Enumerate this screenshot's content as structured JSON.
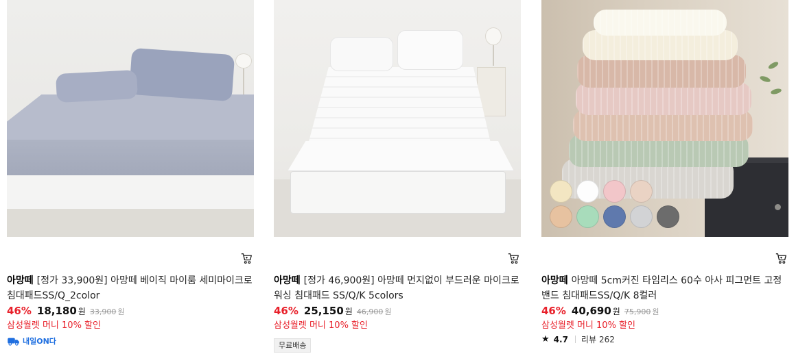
{
  "products": [
    {
      "brand": "아망떼",
      "title": "[정가 33,900원] 아망떼 베이직 마이룸 세미마이크로 침대패드SS/Q_2color",
      "discount": "46%",
      "price": "18,180",
      "currency": "원",
      "original_price": "33,900",
      "promo": "삼성월렛 머니 10% 할인",
      "delivery_badge": "내일ON다",
      "image": "grey-bed-pad-photo"
    },
    {
      "brand": "아망떼",
      "title": "[정가 46,900원] 아망떼 먼지없이 부드러운 마이크로 워싱 침대패드 SS/Q/K 5colors",
      "discount": "46%",
      "price": "25,150",
      "currency": "원",
      "original_price": "46,900",
      "promo": "삼성월렛 머니 10% 할인",
      "shipping_badge": "무료배송",
      "image": "white-bed-pad-photo"
    },
    {
      "brand": "아망떼",
      "title": "아망떼 5cm커진 타임리스 60수 아사 피그먼트 고정밴드 침대패드SS/Q/K 8컬러",
      "discount": "46%",
      "price": "40,690",
      "currency": "원",
      "original_price": "75,900",
      "promo": "삼성월렛 머니 10% 할인",
      "rating": "4.7",
      "review_label": "리뷰",
      "review_count": "262",
      "image": "folded-pads-photo",
      "swatch_colors": [
        "#f3e6c2",
        "#fdfdfd",
        "#f2c6c9",
        "#ead3c4",
        "#e7c2a0",
        "#a8dcbb",
        "#5f79ad",
        "#d2d3d5",
        "#6c6c6c"
      ]
    }
  ],
  "colors": {
    "discount": "#e8202a",
    "promo": "#e8202a",
    "delivery": "#1f6fe0"
  },
  "icons": {
    "cart": "cart-icon",
    "star": "star-icon",
    "delivery": "delivery-logo-icon"
  }
}
